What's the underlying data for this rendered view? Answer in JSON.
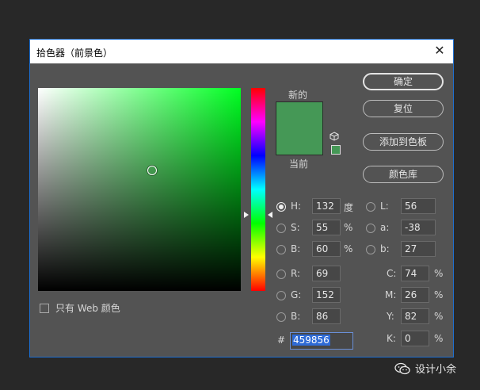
{
  "dialog": {
    "title": "拾色器（前景色）",
    "close_glyph": "✕",
    "web_only_label": "只有 Web 颜色",
    "new_label": "新的",
    "current_label": "当前",
    "current_color": "#459856"
  },
  "buttons": {
    "ok": "确定",
    "reset": "复位",
    "add_swatch": "添加到色板",
    "libraries": "颜色库"
  },
  "hsb": {
    "h": {
      "label": "H:",
      "value": "132",
      "unit": "度",
      "selected": true
    },
    "s": {
      "label": "S:",
      "value": "55",
      "unit": "%"
    },
    "b": {
      "label": "B:",
      "value": "60",
      "unit": "%"
    }
  },
  "rgb": {
    "r": {
      "label": "R:",
      "value": "69"
    },
    "g": {
      "label": "G:",
      "value": "152"
    },
    "b": {
      "label": "B:",
      "value": "86"
    }
  },
  "lab": {
    "l": {
      "label": "L:",
      "value": "56"
    },
    "a": {
      "label": "a:",
      "value": "-38"
    },
    "b": {
      "label": "b:",
      "value": "27"
    }
  },
  "cmyk": {
    "c": {
      "label": "C:",
      "value": "74",
      "unit": "%"
    },
    "m": {
      "label": "M:",
      "value": "26",
      "unit": "%"
    },
    "y": {
      "label": "Y:",
      "value": "82",
      "unit": "%"
    },
    "k": {
      "label": "K:",
      "value": "0",
      "unit": "%"
    }
  },
  "hex": {
    "label": "#",
    "value": "459856"
  },
  "watermark": {
    "text": "设计小余",
    "icon": "wechat-icon"
  }
}
